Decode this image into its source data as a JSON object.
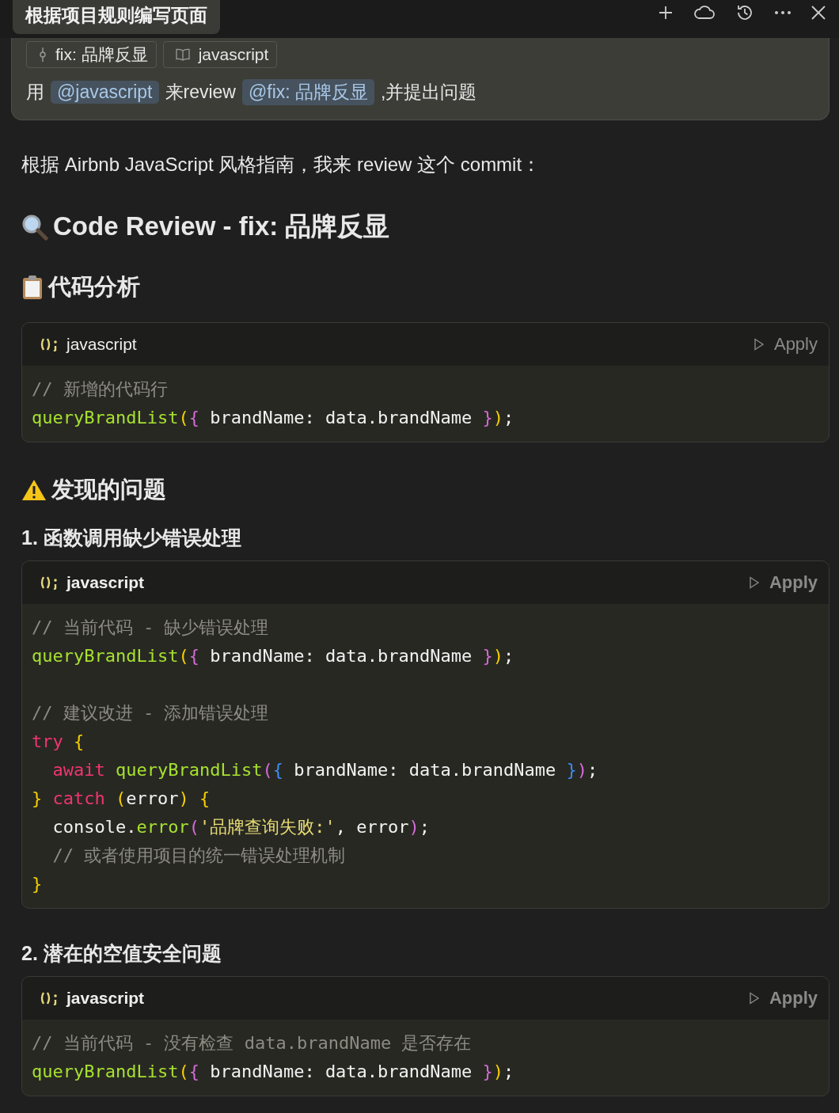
{
  "window": {
    "title": "根据项目规则编写页面",
    "actions": [
      {
        "kind": "add"
      },
      {
        "kind": "cloud"
      },
      {
        "kind": "history"
      },
      {
        "kind": "more"
      },
      {
        "kind": "close"
      }
    ]
  },
  "prompt": {
    "chips": [
      {
        "kind": "commit",
        "label": "fix: 品牌反显"
      },
      {
        "kind": "docs",
        "label": "javascript"
      }
    ],
    "message": [
      {
        "kind": "text",
        "text": "用"
      },
      {
        "kind": "mention",
        "text": "@javascript"
      },
      {
        "kind": "text",
        "text": "来review"
      },
      {
        "kind": "mention",
        "text": "@fix: 品牌反显"
      },
      {
        "kind": "text",
        "text": ",并提出问题"
      }
    ]
  },
  "content": [
    {
      "kind": "paragraph",
      "text": "根据 Airbnb JavaScript 风格指南，我来 review 这个 commit："
    },
    {
      "kind": "title",
      "text": "Code Review - fix: 品牌反显"
    },
    {
      "kind": "analysis",
      "text": "代码分析"
    },
    {
      "kind": "code",
      "language": "javascript",
      "bold": false,
      "action": "Apply",
      "lines": [
        {
          "kind": "code",
          "tokens": [
            {
              "kind": "comment",
              "text": "// 新增的代码行"
            }
          ]
        },
        {
          "kind": "code",
          "tokens": [
            {
              "kind": "func",
              "text": "queryBrandList"
            },
            {
              "kind": "bracket1",
              "text": "("
            },
            {
              "kind": "bracket2",
              "text": "{"
            },
            {
              "kind": "plain",
              "text": " brandName: data.brandName "
            },
            {
              "kind": "bracket2",
              "text": "}"
            },
            {
              "kind": "bracket1",
              "text": ")"
            },
            {
              "kind": "plain",
              "text": ";"
            }
          ]
        }
      ]
    },
    {
      "kind": "issues",
      "text": "发现的问题"
    },
    {
      "kind": "issue",
      "text": "1. 函数调用缺少错误处理"
    },
    {
      "kind": "code",
      "language": "javascript",
      "bold": true,
      "action": "Apply",
      "lines": [
        {
          "kind": "code",
          "tokens": [
            {
              "kind": "comment",
              "text": "// 当前代码 - 缺少错误处理"
            }
          ]
        },
        {
          "kind": "code",
          "tokens": [
            {
              "kind": "func",
              "text": "queryBrandList"
            },
            {
              "kind": "bracket1",
              "text": "("
            },
            {
              "kind": "bracket2",
              "text": "{"
            },
            {
              "kind": "plain",
              "text": " brandName: data.brandName "
            },
            {
              "kind": "bracket2",
              "text": "}"
            },
            {
              "kind": "bracket1",
              "text": ")"
            },
            {
              "kind": "plain",
              "text": ";"
            }
          ]
        },
        {
          "kind": "blank"
        },
        {
          "kind": "code",
          "tokens": [
            {
              "kind": "comment",
              "text": "// 建议改进 - 添加错误处理"
            }
          ]
        },
        {
          "kind": "code",
          "tokens": [
            {
              "kind": "keyword",
              "text": "try"
            },
            {
              "kind": "bracket1",
              "text": " {"
            }
          ]
        },
        {
          "kind": "code",
          "tokens": [
            {
              "kind": "keyword",
              "text": "  await"
            },
            {
              "kind": "func",
              "text": " queryBrandList"
            },
            {
              "kind": "bracket2",
              "text": "("
            },
            {
              "kind": "bracket3",
              "text": "{"
            },
            {
              "kind": "plain",
              "text": " brandName: data.brandName "
            },
            {
              "kind": "bracket3",
              "text": "}"
            },
            {
              "kind": "bracket2",
              "text": ")"
            },
            {
              "kind": "plain",
              "text": ";"
            }
          ]
        },
        {
          "kind": "code",
          "tokens": [
            {
              "kind": "bracket1",
              "text": "}"
            },
            {
              "kind": "keyword",
              "text": " catch"
            },
            {
              "kind": "bracket1",
              "text": " ("
            },
            {
              "kind": "plain",
              "text": "error"
            },
            {
              "kind": "bracket1",
              "text": ")"
            },
            {
              "kind": "bracket1",
              "text": " {"
            }
          ]
        },
        {
          "kind": "code",
          "tokens": [
            {
              "kind": "plain",
              "text": "  console."
            },
            {
              "kind": "func",
              "text": "error"
            },
            {
              "kind": "bracket2",
              "text": "("
            },
            {
              "kind": "string",
              "text": "'品牌查询失败:'"
            },
            {
              "kind": "plain",
              "text": ", error"
            },
            {
              "kind": "bracket2",
              "text": ")"
            },
            {
              "kind": "plain",
              "text": ";"
            }
          ]
        },
        {
          "kind": "code",
          "tokens": [
            {
              "kind": "comment",
              "text": "  // 或者使用项目的统一错误处理机制"
            }
          ]
        },
        {
          "kind": "code",
          "tokens": [
            {
              "kind": "bracket1",
              "text": "}"
            }
          ]
        }
      ]
    },
    {
      "kind": "issue",
      "text": "2. 潜在的空值安全问题"
    },
    {
      "kind": "code",
      "language": "javascript",
      "bold": true,
      "action": "Apply",
      "lines": [
        {
          "kind": "code",
          "tokens": [
            {
              "kind": "comment",
              "text": "// 当前代码 - 没有检查 data.brandName 是否存在"
            }
          ]
        },
        {
          "kind": "code",
          "tokens": [
            {
              "kind": "func",
              "text": "queryBrandList"
            },
            {
              "kind": "bracket1",
              "text": "("
            },
            {
              "kind": "bracket2",
              "text": "{"
            },
            {
              "kind": "plain",
              "text": " brandName: data.brandName "
            },
            {
              "kind": "bracket2",
              "text": "}"
            },
            {
              "kind": "bracket1",
              "text": ")"
            },
            {
              "kind": "plain",
              "text": ";"
            }
          ]
        }
      ]
    }
  ]
}
